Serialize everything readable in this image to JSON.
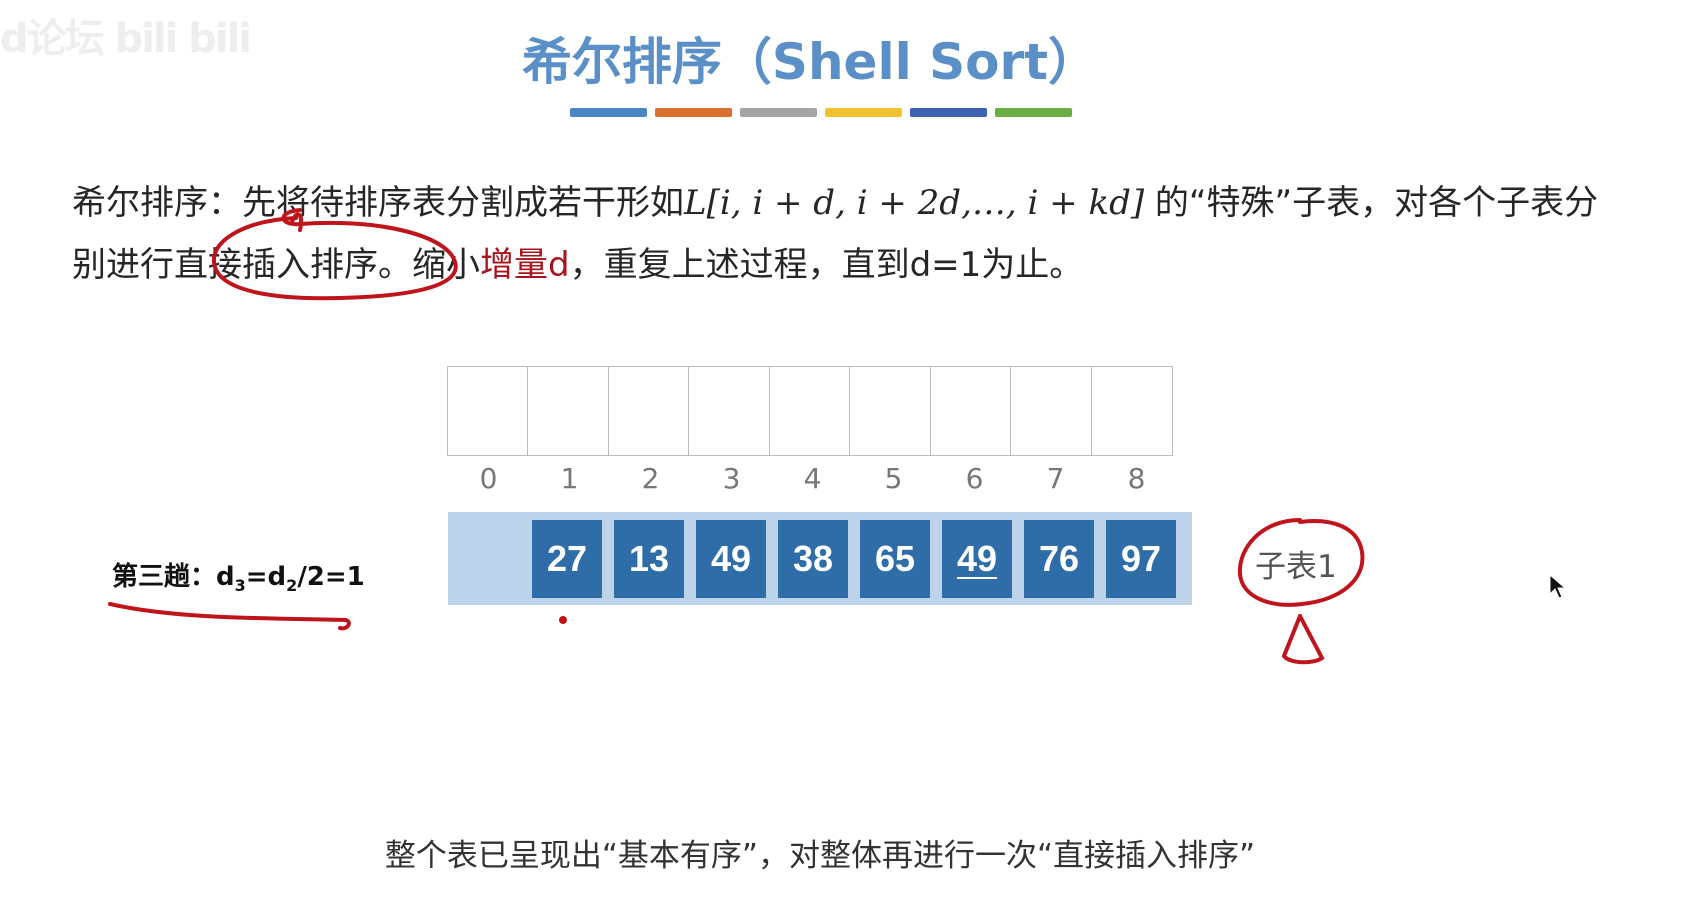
{
  "watermark": "d论坛 bili bili",
  "title": "希尔排序（Shell Sort）",
  "accent_colors": [
    "#4a86c5",
    "#d86f2e",
    "#a4a4a4",
    "#f2c12f",
    "#3e62b2",
    "#6aad45"
  ],
  "description": {
    "part1": "希尔排序：先将待排序表分割成若干形如",
    "formula": "L[i, i + d, i + 2d,…, i + kd]",
    "part2": "的“特殊”子表，对各个子表分别进行直接插入排序。缩小",
    "highlight": "增量d",
    "part3": "，重复上述过程，直到d=1为止。"
  },
  "table": {
    "indices": [
      "0",
      "1",
      "2",
      "3",
      "4",
      "5",
      "6",
      "7",
      "8"
    ],
    "values": [
      "27",
      "13",
      "49",
      "38",
      "65",
      "49",
      "76",
      "97"
    ],
    "underlined_value_position": 5
  },
  "pass_label": {
    "prefix": "第三趟：d",
    "sub1": "3",
    "mid": "=d",
    "sub2": "2",
    "suffix": "/2=1"
  },
  "sublist_label": "子表1",
  "bottom_note": "整个表已呈现出“基本有序”，对整体再进行一次“直接插入排序”",
  "annotation_color": "#c0141c"
}
